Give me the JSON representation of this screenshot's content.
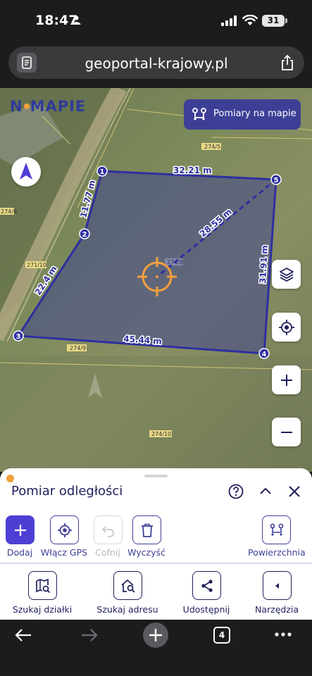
{
  "status": {
    "time": "18:47",
    "battery": "31"
  },
  "browser": {
    "url": "geoportal-krajowy.pl",
    "tab_count": "4"
  },
  "map": {
    "logo": {
      "part1": "N",
      "part2": "MAPIE"
    },
    "measure_button_label": "Pomiary na mapie",
    "vertex_labels": [
      "1",
      "2",
      "3",
      "4",
      "5"
    ],
    "segment_labels": [
      "32.21 m",
      "11.77 m",
      "22.4 m",
      "45.44 m",
      "31.91 m",
      "28.55 m"
    ],
    "parcel_labels": [
      "274/5",
      "274/9",
      "274/10",
      "274/6",
      "271/10",
      "274/8"
    ],
    "colors": {
      "polygon": "#2e2fa0",
      "crosshair": "#f2a03d"
    }
  },
  "sheet": {
    "title": "Pomiar odległości",
    "tools": {
      "add": "Dodaj",
      "gps": "Włącz GPS",
      "undo": "Cofnij",
      "clear": "Wyczyść",
      "area": "Powierzchnia"
    },
    "nav": {
      "search_parcel": "Szukaj działki",
      "search_address": "Szukaj adresu",
      "share": "Udostępnij",
      "tools": "Narzędzia"
    }
  }
}
